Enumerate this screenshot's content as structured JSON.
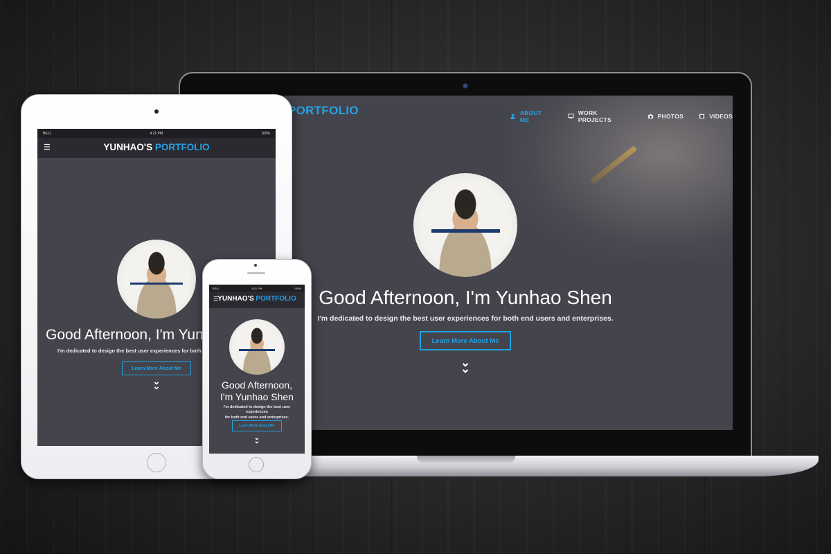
{
  "laptop": {
    "brand_highlight": "PORTFOLIO",
    "nav": [
      {
        "label": "ABOUT ME",
        "icon": "user-icon",
        "active": true
      },
      {
        "label": "WORK PROJECTS",
        "icon": "monitor-icon",
        "active": false
      },
      {
        "label": "PHOTOS",
        "icon": "camera-icon",
        "active": false
      },
      {
        "label": "VIDEOS",
        "icon": "film-icon",
        "active": false
      }
    ],
    "heading": "Good Afternoon, I'm Yunhao Shen",
    "subheading": "I'm dedicated to design the best user experiences for both end users and enterprises.",
    "button_label": "Learn More About Me",
    "scroll_icon": "double-chevron-down-icon"
  },
  "tablet": {
    "status": {
      "carrier": "BELL",
      "time": "4:21 PM",
      "battery": "100%"
    },
    "brand_name": "YUNHAO'S",
    "brand_highlight": "PORTFOLIO",
    "heading": "Good Afternoon, I'm Yun",
    "subheading": "I'm dedicated to design the best user experiences for both end",
    "button_label": "Learn More About Me",
    "menu_icon": "hamburger-menu-icon"
  },
  "phone": {
    "status": {
      "carrier": "BELL",
      "time": "4:21 PM",
      "battery": "100%"
    },
    "brand_name": "YUNHAO'S",
    "brand_highlight": "PORTFOLIO",
    "heading_line1": "Good Afternoon,",
    "heading_line2": "I'm Yunhao Shen",
    "subheading_line1": "I'm dedicated to design the best user experiences",
    "subheading_line2": "for both end users and enterprises.",
    "button_label": "Learn More About Me"
  },
  "colors": {
    "accent": "#22a3e6",
    "screen_bg": "#44444c",
    "appbar": "#2a2a30"
  }
}
